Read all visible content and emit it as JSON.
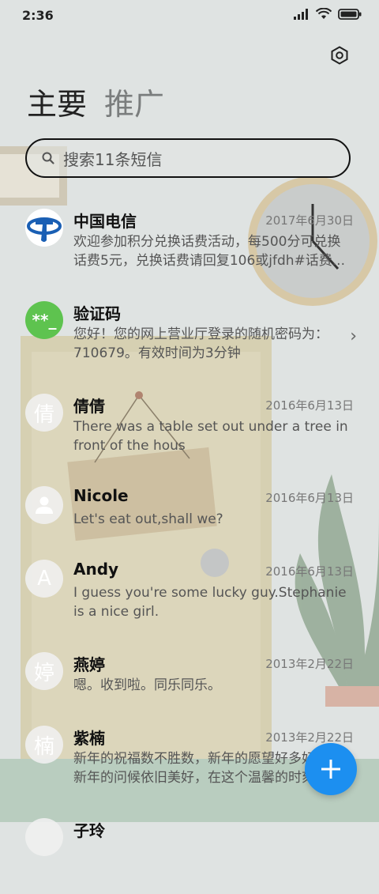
{
  "status": {
    "time": "2:36"
  },
  "tabs": {
    "primary": "主要",
    "promo": "推广"
  },
  "search": {
    "placeholder": "搜索11条短信"
  },
  "messages": [
    {
      "name": "中国电信",
      "date": "2017年6月30日",
      "preview": "欢迎参加积分兑换话费活动，每500分可兑换话费5元，兑换话费请回复106或jfdh#话费...",
      "avatar": "china-telecom-logo"
    },
    {
      "name": "验证码",
      "date": "",
      "preview": "您好！您的网上营业厅登录的随机密码为：710679。有效时间为3分钟",
      "avatar_text": "**_"
    },
    {
      "name": "倩倩",
      "date": "2016年6月13日",
      "preview": "There was a table set out under a tree in front of the hous",
      "avatar_text": "倩"
    },
    {
      "name": "Nicole",
      "date": "2016年6月13日",
      "preview": "Let's eat out,shall we?",
      "avatar": "person-icon"
    },
    {
      "name": "Andy",
      "date": "2016年6月13日",
      "preview": "I guess you're some lucky guy.Stephanie is a nice girl.",
      "avatar_text": "A"
    },
    {
      "name": "燕婷",
      "date": "2013年2月22日",
      "preview": "嗯。收到啦。同乐同乐。",
      "avatar_text": "婷"
    },
    {
      "name": "紫楠",
      "date": "2013年2月22日",
      "preview": "新年的祝福数不胜数，新年的愿望好多好多，新年的问候依旧美好，在这个温馨的时刻",
      "avatar_text": "楠"
    },
    {
      "name": "子玲",
      "date": "",
      "preview": "",
      "avatar_text": ""
    }
  ],
  "colors": {
    "accent": "#1c8ff0",
    "verify_avatar": "#5ec34f",
    "telecom_blue": "#1a5fb4"
  }
}
